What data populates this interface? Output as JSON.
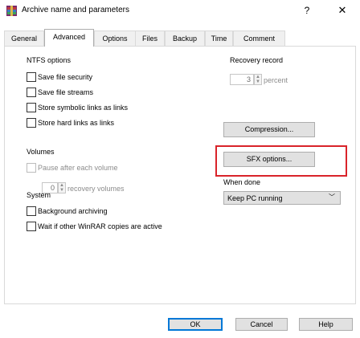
{
  "window": {
    "title": "Archive name and parameters",
    "help_glyph": "?",
    "close_glyph": "✕"
  },
  "tabs": [
    {
      "label": "General"
    },
    {
      "label": "Advanced"
    },
    {
      "label": "Options"
    },
    {
      "label": "Files"
    },
    {
      "label": "Backup"
    },
    {
      "label": "Time"
    },
    {
      "label": "Comment"
    }
  ],
  "ntfs": {
    "title": "NTFS options",
    "items": [
      {
        "label": "Save file security"
      },
      {
        "label": "Save file streams"
      },
      {
        "label": "Store symbolic links as links"
      },
      {
        "label": "Store hard links as links"
      }
    ]
  },
  "recovery": {
    "title": "Recovery record",
    "value": "3",
    "unit": "percent"
  },
  "compression_button": "Compression...",
  "sfx_button": "SFX options...",
  "volumes": {
    "title": "Volumes",
    "pause_label": "Pause after each volume",
    "recovery_value": "0",
    "recovery_label": "recovery volumes"
  },
  "when_done": {
    "label": "When done",
    "selected": "Keep PC running"
  },
  "system": {
    "title": "System",
    "items": [
      {
        "label": "Background archiving"
      },
      {
        "label": "Wait if other WinRAR copies are active"
      }
    ]
  },
  "footer": {
    "ok": "OK",
    "cancel": "Cancel",
    "help": "Help"
  },
  "colors": {
    "highlight": "#d9232a",
    "default_button_border": "#0078d7"
  },
  "icons": {
    "app": "winrar-icon",
    "spin": "spinner-arrows-icon",
    "dropdown": "chevron-down-icon"
  }
}
